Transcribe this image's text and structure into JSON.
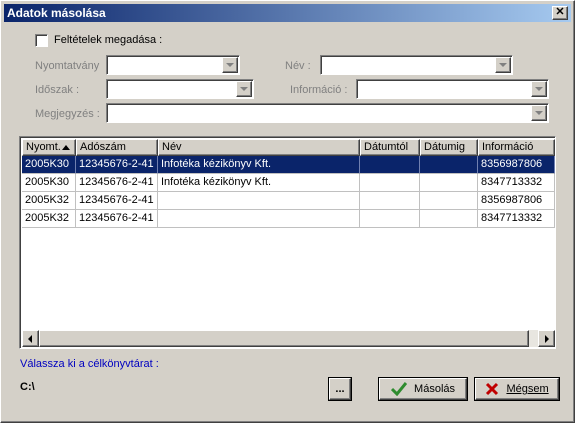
{
  "window": {
    "title": "Adatok másolása",
    "close_glyph": "✕"
  },
  "filters": {
    "checkbox_label": "Feltételek megadása :",
    "nyomtatvany_label": "Nyomtatvány",
    "nev_label": "Név :",
    "idoszak_label": "Időszak :",
    "informacio_label": "Információ :",
    "megjegyzes_label": "Megjegyzés :"
  },
  "table": {
    "columns": [
      "Nyomt.",
      "Adószám",
      "Név",
      "Dátumtól",
      "Dátumig",
      "Információ"
    ],
    "rows": [
      [
        "2005K30",
        "12345676-2-41",
        "Infotéka kézikönyv Kft.",
        "",
        "",
        "8356987806"
      ],
      [
        "2005K30",
        "12345676-2-41",
        "Infotéka kézikönyv Kft.",
        "",
        "",
        "8347713332"
      ],
      [
        "2005K32",
        "12345676-2-41",
        "",
        "",
        "",
        "8356987806"
      ],
      [
        "2005K32",
        "12345676-2-41",
        "",
        "",
        "",
        "8347713332"
      ]
    ],
    "selected_row_index": 0
  },
  "target": {
    "label": "Válassza ki a célkönyvtárat :",
    "path": "C:\\"
  },
  "buttons": {
    "browse": "...",
    "copy": "Másolás",
    "cancel": "Mégsem"
  },
  "icons": {
    "copy": "checkmark-icon",
    "cancel": "x-icon"
  },
  "colors": {
    "titlebar_start": "#0a246a",
    "titlebar_end": "#a6caf0",
    "selection": "#0a246a",
    "target_label": "#0000c0",
    "check_green": "#2e8b2e",
    "cancel_red": "#c00000"
  }
}
